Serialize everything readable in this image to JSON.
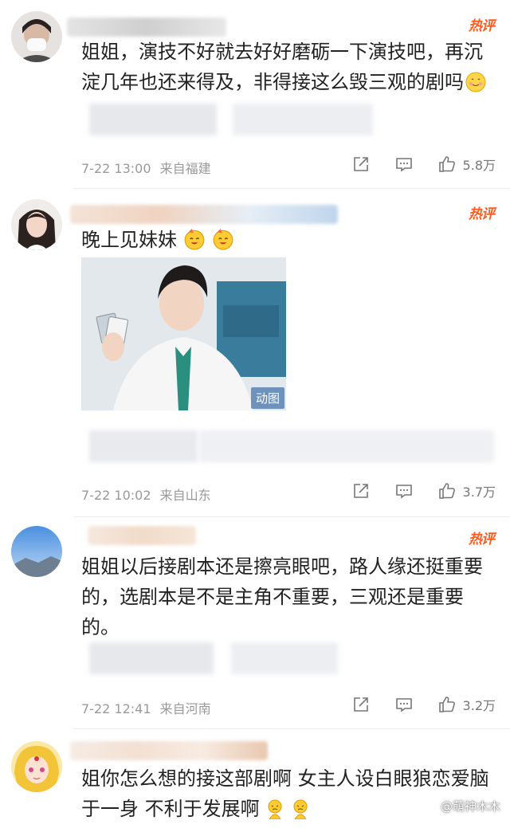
{
  "hot_label": "热评",
  "comments": [
    {
      "text": "姐姐，演技不好就去好好磨砺一下演技吧，再沉淀几年也还来得及，非得接这么毁三观的剧吗",
      "time": "7-22 13:00",
      "location": "来自福建",
      "likes": "5.8万"
    },
    {
      "text": "晚上见妹妹",
      "gif_badge": "动图",
      "time": "7-22 10:02",
      "location": "来自山东",
      "likes": "3.7万"
    },
    {
      "text": "姐姐以后接剧本还是擦亮眼吧，路人缘还挺重要的，选剧本是不是主角不重要，三观还是重要的。",
      "time": "7-22 12:41",
      "location": "来自河南",
      "likes": "3.2万"
    },
    {
      "text": "姐你怎么想的接这部剧啊 女主人设白眼狼恋爱脑于一身 不利于发展啊"
    }
  ],
  "watermark": "@萌神木木",
  "colors": {
    "hot": "#ff5a1f",
    "meta": "#999999",
    "badge": "#5a82b4"
  }
}
